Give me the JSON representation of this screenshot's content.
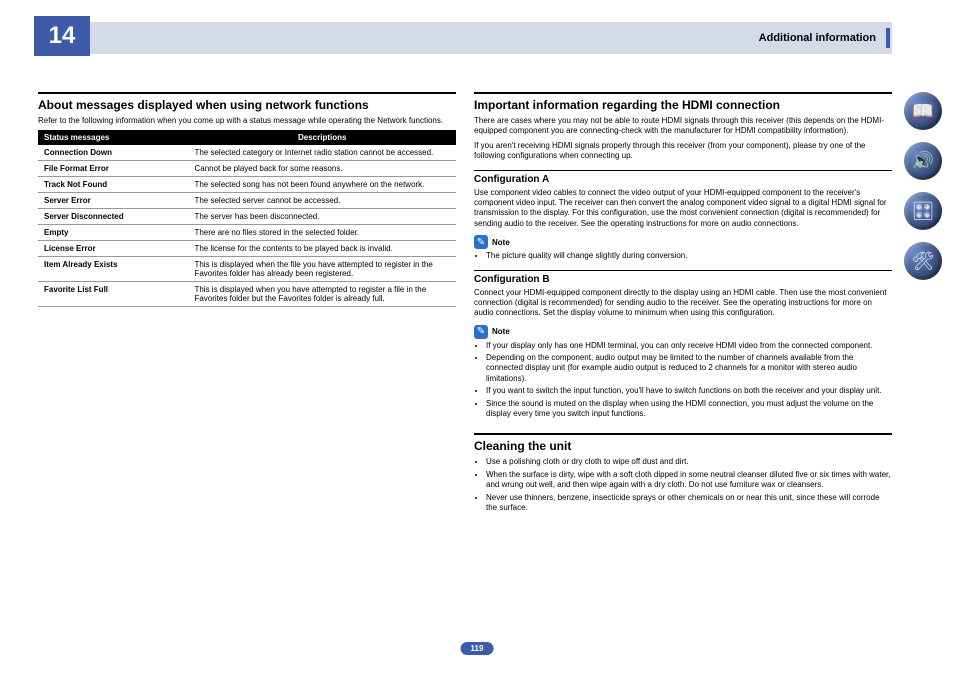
{
  "header": {
    "chapter": "14",
    "title": "Additional information"
  },
  "left": {
    "heading": "About messages displayed when using network functions",
    "intro": "Refer to the following information when you come up with a status message while operating the Network functions.",
    "table": {
      "head_status": "Status messages",
      "head_desc": "Descriptions",
      "rows": [
        {
          "s": "Connection Down",
          "d": "The selected category or Internet radio station cannot be accessed."
        },
        {
          "s": "File Format Error",
          "d": "Cannot be played back for some reasons."
        },
        {
          "s": "Track Not Found",
          "d": "The selected song has not been found anywhere on the network."
        },
        {
          "s": "Server Error",
          "d": "The selected server cannot be accessed."
        },
        {
          "s": "Server Disconnected",
          "d": "The server has been disconnected."
        },
        {
          "s": "Empty",
          "d": "There are no files stored in the selected folder."
        },
        {
          "s": "License Error",
          "d": "The license for the contents to be played back is invalid."
        },
        {
          "s": "Item Already Exists",
          "d": "This is displayed when the file you have attempted to register in the Favorites folder has already been registered."
        },
        {
          "s": "Favorite List Full",
          "d": "This is displayed when you have attempted to register a file in the Favorites folder but the Favorites folder is already full."
        }
      ]
    }
  },
  "right": {
    "heading": "Important information regarding the HDMI connection",
    "intro1": "There are cases where you may not be able to route HDMI signals through this receiver (this depends on the HDMI-equipped component you are connecting-check with the manufacturer for HDMI compatibility information).",
    "intro2": "If you aren't receiving HDMI signals properly through this receiver (from your component), please try one of the following configurations when connecting up.",
    "confA_h": "Configuration A",
    "confA_p": "Use component video cables to connect the video output of your HDMI-equipped component to the receiver's component video input. The receiver can then convert the analog component video signal to a digital HDMI signal for transmission to the display. For this configuration, use the most convenient connection (digital is recommended) for sending audio to the receiver. See the operating instructions for more on audio connections.",
    "note_label": "Note",
    "noteA_item": "The picture quality will change slightly during conversion.",
    "confB_h": "Configuration B",
    "confB_p": "Connect your HDMI-equipped component directly to the display using an HDMI cable. Then use the most convenient connection (digital is recommended) for sending audio to the receiver. See the operating instructions for more on audio connections. Set the display volume to minimum when using this configuration.",
    "noteB_items": [
      "If your display only has one HDMI terminal, you can only receive HDMI video from the connected component.",
      "Depending on the component, audio output may be limited to the number of channels available from the connected display unit (for example audio output is reduced to 2 channels for a monitor with stereo audio limitations).",
      "If you want to switch the input function, you'll have to switch functions on both the receiver and your display unit.",
      "Since the sound is muted on the display when using the HDMI connection, you must adjust the volume on the display every time you switch input functions."
    ],
    "clean_h": "Cleaning the unit",
    "clean_items": [
      "Use a polishing cloth or dry cloth to wipe off dust and dirt.",
      "When the surface is dirty, wipe with a soft cloth dipped in some neutral cleanser diluted five or six times with water, and wrung out well, and then wipe again with a dry cloth. Do not use furniture wax or cleansers.",
      "Never use thinners, benzene, insecticide sprays or other chemicals on or near this unit, since these will corrode the surface."
    ]
  },
  "page": "119"
}
